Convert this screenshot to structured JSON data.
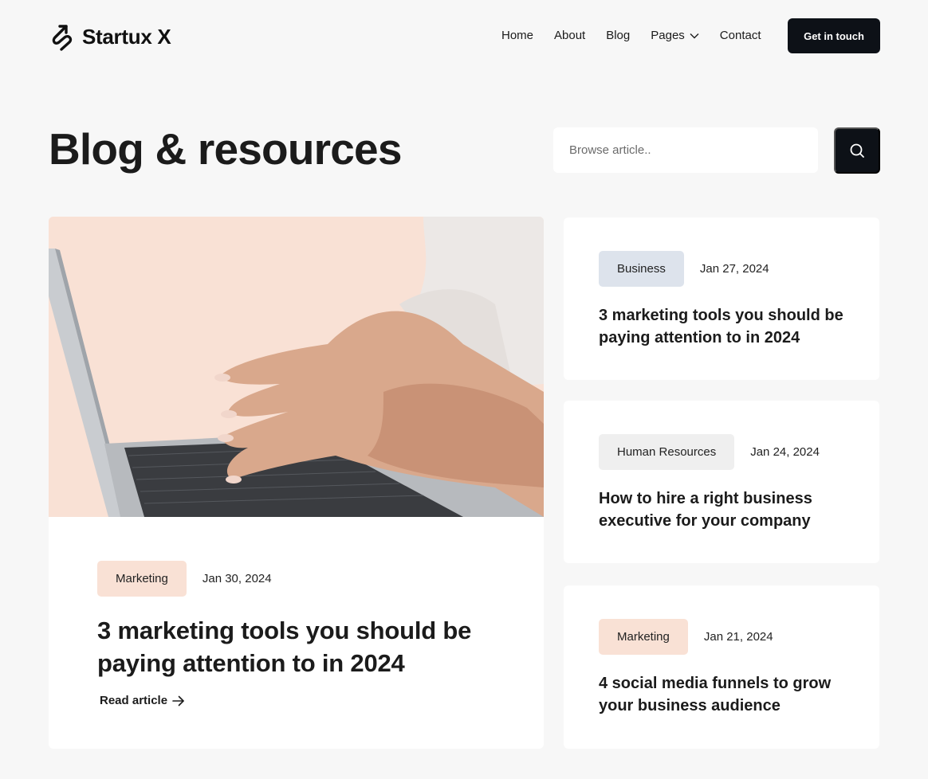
{
  "brand": {
    "name": "Startux X",
    "icon": "route-arrow-icon"
  },
  "nav": {
    "items": [
      {
        "label": "Home"
      },
      {
        "label": "About"
      },
      {
        "label": "Blog"
      },
      {
        "label": "Pages",
        "has_dropdown": true
      },
      {
        "label": "Contact"
      }
    ],
    "cta_label": "Get in touch"
  },
  "page": {
    "title": "Blog & resources",
    "search_placeholder": "Browse article.."
  },
  "featured": {
    "tag": "Marketing",
    "tag_color": "#f9e1d5",
    "date": "Jan 30, 2024",
    "title": "3 marketing tools you should be paying attention to in 2024",
    "link_label": "Read article"
  },
  "articles": [
    {
      "tag": "Business",
      "tag_color": "#dde3ec",
      "date": "Jan 27, 2024",
      "title": "3 marketing tools you should be paying attention to in 2024"
    },
    {
      "tag": "Human Resources",
      "tag_color": "#efefef",
      "date": "Jan 24, 2024",
      "title": "How to hire a right business executive for your company"
    },
    {
      "tag": "Marketing",
      "tag_color": "#f9e1d5",
      "date": "Jan 21, 2024",
      "title": "4 social media funnels to grow your business audience"
    }
  ],
  "colors": {
    "background": "#f7f7f7",
    "dark": "#0d1117",
    "peach": "#f9e1d5"
  }
}
